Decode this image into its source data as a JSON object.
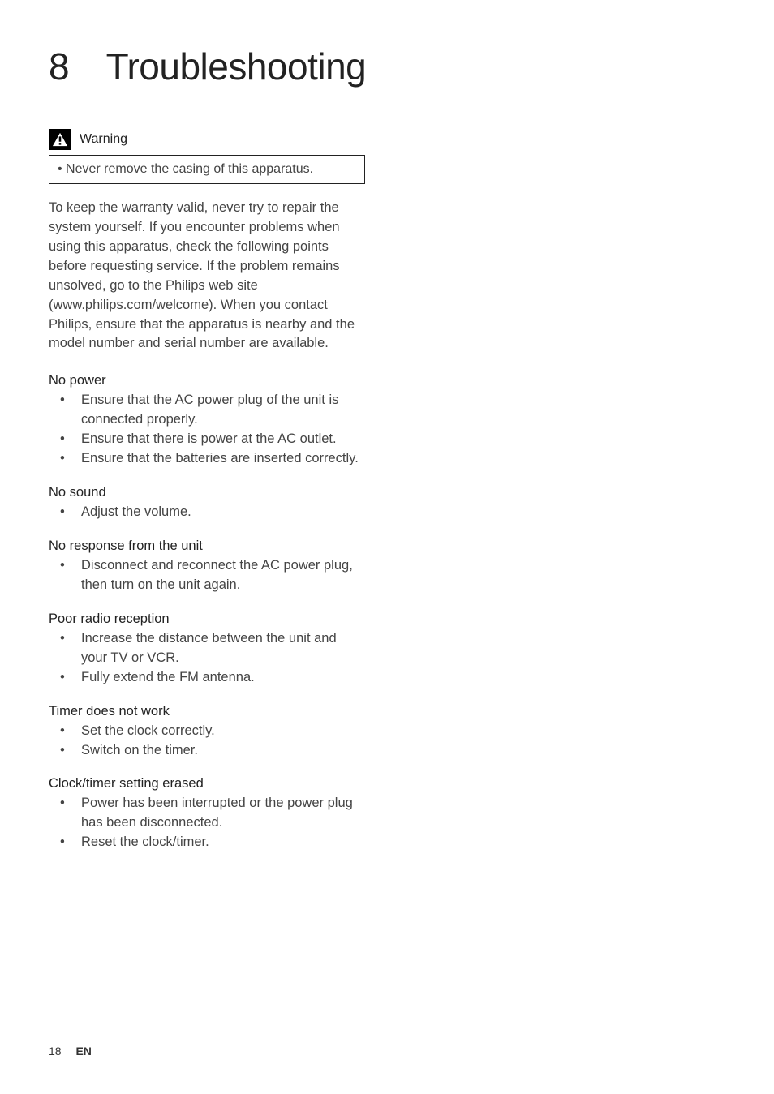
{
  "title": "8 Troubleshooting",
  "warning": {
    "label": "Warning",
    "bullet": "•  Never remove the casing of this apparatus."
  },
  "intro": "To keep the warranty valid, never try to repair the system yourself.\nIf you encounter problems when using this apparatus, check the following points before requesting service. If the problem remains unsolved, go to the Philips web site (www.philips.com/welcome). When you contact Philips, ensure that the apparatus is nearby and the model number and serial number are available.",
  "sections": [
    {
      "heading": "No power",
      "items": [
        "Ensure that the AC power plug of the unit is connected properly.",
        "Ensure that there is power at the AC outlet.",
        "Ensure that the batteries are inserted correctly."
      ]
    },
    {
      "heading": "No sound",
      "items": [
        "Adjust the volume."
      ]
    },
    {
      "heading": "No response from the unit",
      "items": [
        "Disconnect and reconnect the AC power plug, then turn on the unit again."
      ]
    },
    {
      "heading": "Poor radio reception",
      "items": [
        "Increase the distance between the unit and your TV or VCR.",
        "Fully extend the FM antenna."
      ]
    },
    {
      "heading": "Timer does not work",
      "items": [
        "Set the clock correctly.",
        "Switch on the timer."
      ]
    },
    {
      "heading": "Clock/timer setting erased",
      "items": [
        "Power has been interrupted or the power plug has been disconnected.",
        "Reset the clock/timer."
      ]
    }
  ],
  "footer": {
    "page": "18",
    "lang": "EN"
  }
}
